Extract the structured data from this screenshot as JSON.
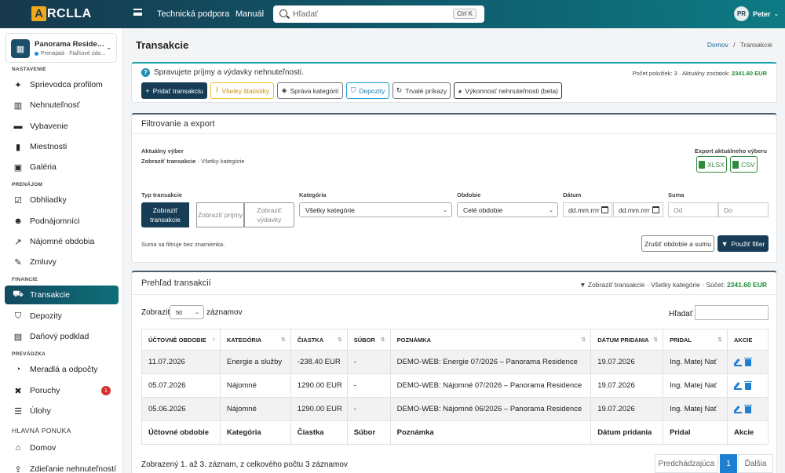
{
  "topbar": {
    "logo_letter": "A",
    "logo_text": "RCLLA",
    "nav": [
      "Technická podpora",
      "Manuál"
    ],
    "search_placeholder": "Hľadať",
    "search_shortcut": "Ctrl K",
    "user_initials": "PR",
    "user_name": "Peter"
  },
  "sidebar": {
    "property_name": "Panorama Residence",
    "property_status": "Prenajatá",
    "property_address": "Fiaľkové údo...",
    "sections": {
      "settings": "NASTAVENIE",
      "rental": "PRENÁJOM",
      "finance": "FINANCIE",
      "maintenance": "PREVÁDZKA",
      "main_menu": "HLAVNÁ PONUKA"
    },
    "items": {
      "profile_guide": "Sprievodca profilom",
      "properties": "Nehnuteľnosť",
      "equipment": "Vybavenie",
      "rooms": "Miestnosti",
      "gallery": "Galéria",
      "viewings": "Obhliadky",
      "tenants": "Podnájomníci",
      "rent_periods": "Nájomné obdobia",
      "contracts": "Zmluvy",
      "transactions": "Transakcie",
      "deposits": "Depozity",
      "tax": "Daňový podklad",
      "meters": "Meradlá a odpočty",
      "issues": "Poruchy",
      "issues_badge": "1",
      "tasks": "Úlohy",
      "home": "Domov",
      "share": "Zdieľanie nehnuteľností"
    }
  },
  "page": {
    "title": "Transakcie",
    "breadcrumb_home": "Domov",
    "breadcrumb_sep": "/",
    "breadcrumb_current": "Transakcie"
  },
  "summary": {
    "hint": "Spravujete príjmy a výdavky nehnuteľnosti.",
    "count_text": "Počet položiek: 3 · Aktuálny zostatok:",
    "balance": "2341.60 EUR",
    "buttons": {
      "add": "Pridať transakciu",
      "stats": "Všetky štatistiky",
      "categories": "Správa kategórií",
      "deposits": "Depozity",
      "recurring": "Trvalé príkazy",
      "performance": "Výkonnosť nehnuteľnosti (beta)"
    }
  },
  "filter": {
    "title": "Filtrovanie a export",
    "current_label": "Aktuálny výber",
    "current_value_bold": "Zobraziť transakcie",
    "current_value_rest": " · Všetky kategórie",
    "export_label": "Export aktuálneho výberu",
    "xlsx": "XLSX",
    "csv": "CSV",
    "type_label": "Typ transakcie",
    "type_all": "Zobraziť transakcie",
    "type_income": "Zobraziť príjmy",
    "type_expense": "Zobraziť výdavky",
    "category_label": "Kategória",
    "category_value": "Všetky kategórie",
    "period_label": "Obdobie",
    "period_value": "Celé obdobie",
    "date_label": "Dátum",
    "date_ph": "dd.mm.rrrr",
    "amount_label": "Suma",
    "amount_from": "Od",
    "amount_to": "Do",
    "amount_note": "Suma sa filtruje bez znamienka.",
    "clear": "Zrušiť obdobie a sumu",
    "apply": "Použiť filter"
  },
  "overview": {
    "title": "Prehľad transakcií",
    "summary_text": "Zobraziť transakcie · Všetky kategórie · Súčet:",
    "summary_total": "2341.60 EUR",
    "show_label": "Zobraziť",
    "show_value": "50",
    "records_label": "záznamov",
    "search_label": "Hľadať",
    "columns": [
      "ÚČTOVNÉ OBDOBIE",
      "KATEGÓRIA",
      "ČIASTKA",
      "SÚBOR",
      "POZNÁMKA",
      "DÁTUM PRIDANIA",
      "PRIDAL",
      "AKCIE"
    ],
    "footer": [
      "Účtovné obdobie",
      "Kategória",
      "Čiastka",
      "Súbor",
      "Poznámka",
      "Dátum pridania",
      "Pridal",
      "Akcie"
    ],
    "rows": [
      {
        "period": "11.07.2026",
        "category": "Energie a služby",
        "amount": "-238.40 EUR",
        "file": "-",
        "note": "DEMO-WEB: Energie 07/2026 – Panorama Residence",
        "date": "19.07.2026",
        "by": "Ing. Matej Nať"
      },
      {
        "period": "05.07.2026",
        "category": "Nájomné",
        "amount": "1290.00 EUR",
        "file": "-",
        "note": "DEMO-WEB: Nájomné 07/2026 – Panorama Residence",
        "date": "19.07.2026",
        "by": "Ing. Matej Nať"
      },
      {
        "period": "05.06.2026",
        "category": "Nájomné",
        "amount": "1290.00 EUR",
        "file": "-",
        "note": "DEMO-WEB: Nájomné 06/2026 – Panorama Residence",
        "date": "19.07.2026",
        "by": "Ing. Matej Nať"
      }
    ],
    "info": "Zobrazený 1. až 3. záznam, z celkového počtu 3 záznamov",
    "prev": "Predchádzajúca",
    "page": "1",
    "next": "Ďalšia"
  },
  "colors": {
    "primary": "#173d56",
    "accent": "#1aa0a8",
    "positive": "#1a8a32",
    "negative": "#d62f2f",
    "link": "#1e7fd0"
  }
}
